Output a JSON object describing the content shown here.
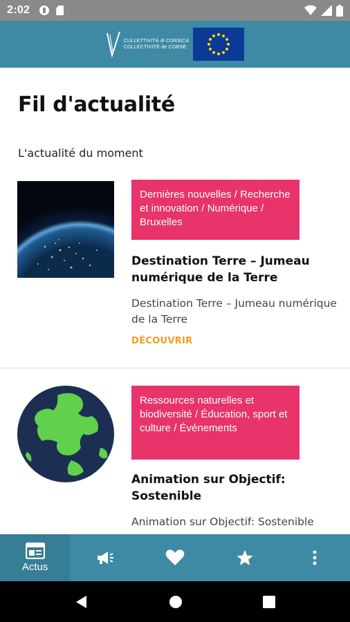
{
  "status_bar": {
    "time": "2:02",
    "icons": [
      "notification-circle-icon",
      "sd-card-icon",
      "wifi-icon",
      "signal-icon",
      "battery-icon"
    ]
  },
  "header": {
    "logo_lines": [
      "CULLETTIVITÀ di CORSICA",
      "COLLECTIVITÉ de CORSE"
    ],
    "colors": {
      "header_bg": "#3e8aa5",
      "eu_blue": "#0a3a96",
      "eu_star": "#ffdd00"
    }
  },
  "page": {
    "title": "Fil d'actualité",
    "subtitle": "L'actualité du moment"
  },
  "articles": [
    {
      "image": "earth-night-from-space",
      "tags": "Dernières nouvelles / Recherche et innovation / Numérique / Bruxelles",
      "title": "Destination Terre – Jumeau numérique de la Terre",
      "description": "Destination Terre – Jumeau numérique de la Terre",
      "link_label": "DÉCOUVRIR"
    },
    {
      "image": "green-globe-illustration",
      "tags": "Ressources naturelles et biodiversité / Éducation, sport et culture / Événements",
      "title": "Animation sur Objectif: Sostenible",
      "description": "Animation sur Objectif: Sostenible"
    }
  ],
  "colors": {
    "tag_bg": "#e8336b",
    "link": "#f39c21",
    "nav_bg": "#3e8aa5"
  },
  "bottom_nav": {
    "items": [
      {
        "icon": "news-icon",
        "label": "Actus",
        "active": true
      },
      {
        "icon": "megaphone-icon",
        "label": ""
      },
      {
        "icon": "heart-icon",
        "label": ""
      },
      {
        "icon": "star-icon",
        "label": ""
      },
      {
        "icon": "more-vertical-icon",
        "label": ""
      }
    ]
  },
  "system_nav": {
    "icons": [
      "back-icon",
      "home-icon",
      "recents-icon"
    ]
  }
}
